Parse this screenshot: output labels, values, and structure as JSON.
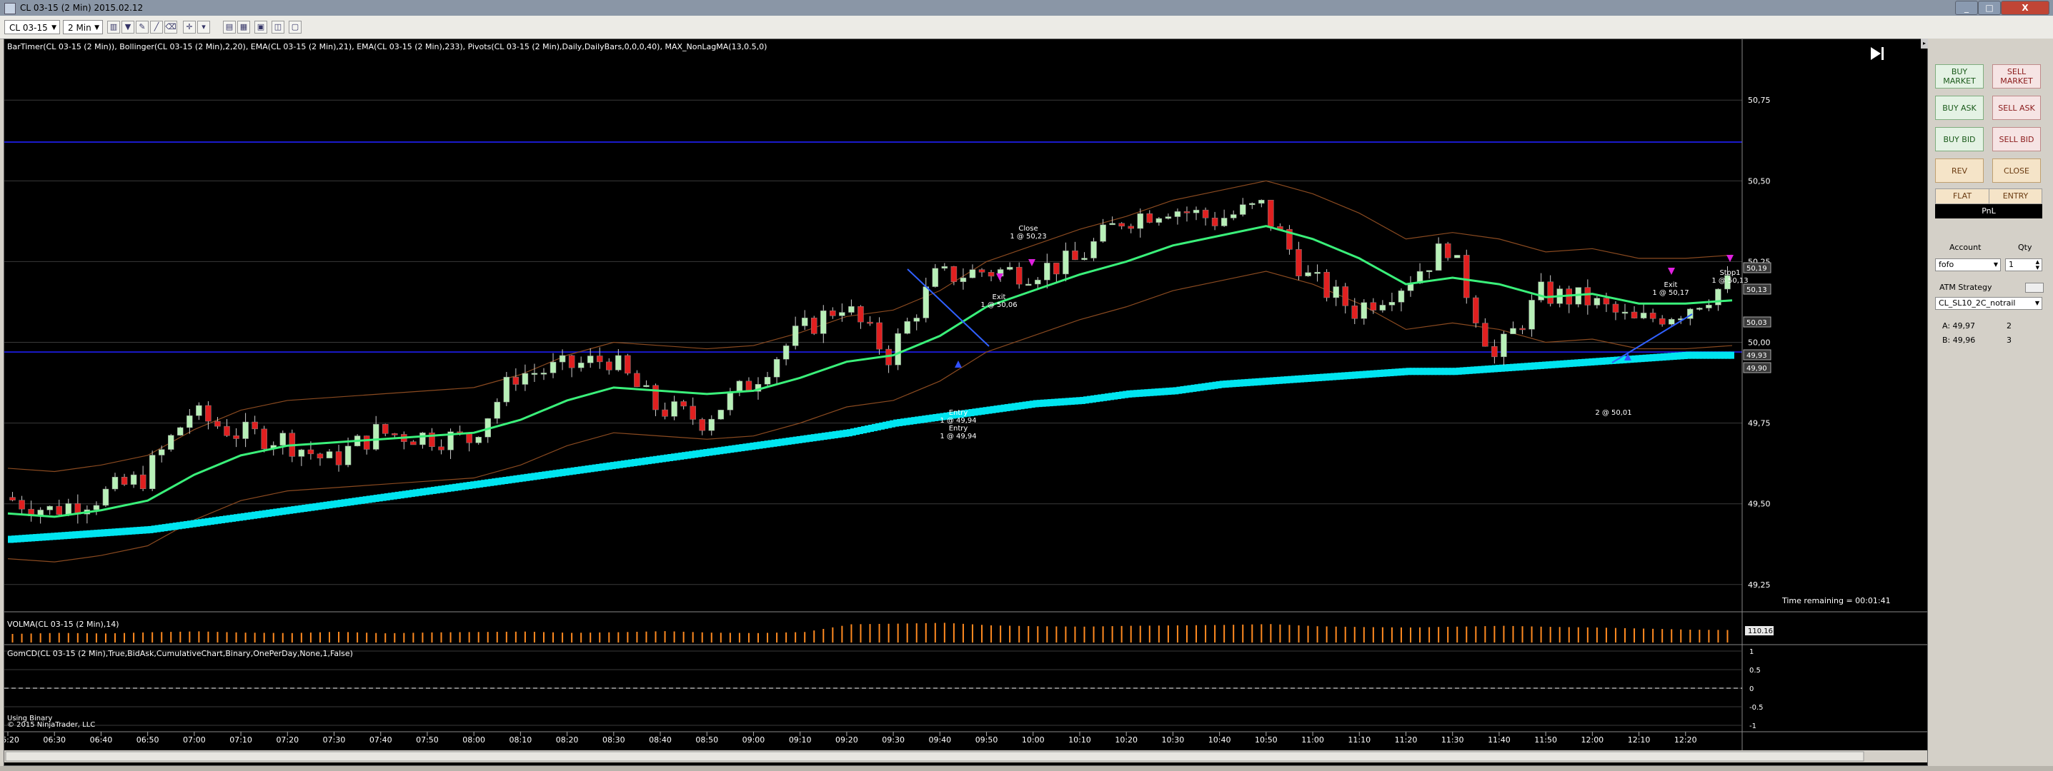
{
  "window": {
    "title": "CL 03-15 (2 Min)  2015.02.12",
    "close_label": "X",
    "min_label": "_",
    "max_label": "□"
  },
  "toolbar": {
    "instrument": "CL 03-15",
    "interval": "2 Min"
  },
  "chart": {
    "indicators_label": "BarTimer(CL 03-15 (2 Min)), Bollinger(CL 03-15 (2 Min),2,20), EMA(CL 03-15 (2 Min),21), EMA(CL 03-15 (2 Min),233), Pivots(CL 03-15 (2 Min),Daily,DailyBars,0,0,0,40), MAX_NonLagMA(13,0.5,0)",
    "time_remaining": "Time remaining = 00:01:41",
    "price_labels": [
      "50,75",
      "50,50",
      "50,25",
      "50,00",
      "49,75",
      "49,50",
      "49,25"
    ],
    "price_flags": [
      {
        "text": "50,19",
        "color": "#ffffff"
      },
      {
        "text": "50,13",
        "color": "#ffffff"
      },
      {
        "text": "50,03",
        "color": "#ffffff"
      },
      {
        "text": "49,93",
        "color": "#ffffff"
      },
      {
        "text": "49,90",
        "color": "#ffffff"
      }
    ],
    "time_labels": [
      "06:20",
      "06:30",
      "06:40",
      "06:50",
      "07:00",
      "07:10",
      "07:20",
      "07:30",
      "07:40",
      "07:50",
      "08:00",
      "08:10",
      "08:20",
      "08:30",
      "08:40",
      "08:50",
      "09:00",
      "09:10",
      "09:20",
      "09:30",
      "09:40",
      "09:50",
      "10:00",
      "10:10",
      "10:20",
      "10:30",
      "10:40",
      "10:50",
      "11:00",
      "11:10",
      "11:20",
      "11:30",
      "11:40",
      "11:50",
      "12:00",
      "12:10",
      "12:20"
    ],
    "volume_label": "VOLMA(CL 03-15 (2 Min),14)",
    "volume_value": "110.16",
    "gomcd_label": "GomCD(CL 03-15 (2 Min),True,BidAsk,CumulativeChart,Binary,OnePerDay,None,1,False)",
    "gomcd_ticks": [
      "1",
      "0.5",
      "0",
      "-0.5",
      "-1"
    ],
    "using_label": "Using Binary",
    "copyright": "© 2015 NinjaTrader, LLC",
    "trade_annotations": [
      {
        "lines": [
          "Close",
          "1 @ 50,23"
        ]
      },
      {
        "lines": [
          "Exit",
          "1 @ 50,06"
        ]
      },
      {
        "lines": [
          "Entry",
          "1 @ 49,94",
          "Entry",
          "1 @ 49,94"
        ]
      },
      {
        "lines": [
          "Exit",
          "1 @ 50,17"
        ]
      },
      {
        "lines": [
          "Stop1",
          "1 @ 50,13"
        ]
      },
      {
        "lines": [
          "2 @ 50,01"
        ]
      }
    ]
  },
  "chart_data": {
    "type": "line",
    "title": "CL 03-15 (2 Min)",
    "xlabel": "",
    "ylabel": "",
    "ylim": [
      49.17,
      50.85
    ],
    "x": [
      "06:20",
      "06:30",
      "06:40",
      "06:50",
      "07:00",
      "07:10",
      "07:20",
      "07:30",
      "07:40",
      "07:50",
      "08:00",
      "08:10",
      "08:20",
      "08:30",
      "08:40",
      "08:50",
      "09:00",
      "09:10",
      "09:20",
      "09:30",
      "09:40",
      "09:50",
      "10:00",
      "10:10",
      "10:20",
      "10:30",
      "10:40",
      "10:50",
      "11:00",
      "11:10",
      "11:20",
      "11:30",
      "11:40",
      "11:50",
      "12:00",
      "12:10",
      "12:20",
      "12:26"
    ],
    "series": [
      {
        "name": "EMA(21)",
        "values": [
          49.47,
          49.46,
          49.48,
          49.51,
          49.59,
          49.65,
          49.68,
          49.69,
          49.7,
          49.71,
          49.72,
          49.76,
          49.82,
          49.86,
          49.85,
          49.84,
          49.85,
          49.89,
          49.94,
          49.96,
          50.02,
          50.11,
          50.16,
          50.21,
          50.25,
          50.3,
          50.33,
          50.36,
          50.32,
          50.26,
          50.18,
          50.2,
          50.18,
          50.14,
          50.15,
          50.12,
          50.12,
          50.13
        ]
      },
      {
        "name": "EMA(233)",
        "values": [
          49.39,
          49.4,
          49.41,
          49.42,
          49.44,
          49.46,
          49.48,
          49.5,
          49.52,
          49.54,
          49.56,
          49.58,
          49.6,
          49.62,
          49.64,
          49.66,
          49.68,
          49.7,
          49.72,
          49.75,
          49.77,
          49.79,
          49.81,
          49.82,
          49.84,
          49.85,
          49.87,
          49.88,
          49.89,
          49.9,
          49.91,
          49.91,
          49.92,
          49.93,
          49.94,
          49.95,
          49.96,
          49.96
        ]
      },
      {
        "name": "Close",
        "values": [
          49.52,
          49.48,
          49.52,
          49.58,
          49.78,
          49.72,
          49.7,
          49.63,
          49.72,
          49.71,
          49.7,
          49.9,
          49.92,
          49.95,
          49.8,
          49.76,
          49.87,
          50.02,
          50.12,
          49.96,
          50.2,
          50.22,
          50.22,
          50.25,
          50.38,
          50.42,
          50.38,
          50.42,
          50.2,
          50.1,
          50.18,
          50.3,
          49.95,
          50.15,
          50.13,
          50.06,
          50.1,
          50.18
        ]
      }
    ],
    "horizontal_lines": [
      50.62,
      49.97
    ],
    "volume": {
      "name": "VOLMA",
      "values": [
        40,
        45,
        42,
        48,
        52,
        46,
        44,
        50,
        43,
        47,
        49,
        51,
        45,
        48,
        53,
        46,
        44,
        49,
        85,
        88,
        92,
        80,
        76,
        74,
        78,
        80,
        82,
        86,
        76,
        72,
        70,
        74,
        78,
        73,
        70,
        65,
        60,
        58
      ]
    },
    "grid": true,
    "legend": "none"
  },
  "order_panel": {
    "buy_market": "BUY MARKET",
    "sell_market": "SELL MARKET",
    "buy_ask": "BUY ASK",
    "sell_ask": "SELL ASK",
    "buy_bid": "BUY BID",
    "sell_bid": "SELL BID",
    "rev": "REV",
    "close": "CLOSE",
    "flat": "FLAT",
    "entry": "ENTRY",
    "pnl": "PnL",
    "account_label": "Account",
    "qty_label": "Qty",
    "account_value": "fofo",
    "qty_value": "1",
    "atm_label": "ATM Strategy",
    "atm_value": "CL_SL10_2C_notrail",
    "ask_label": "A:  49,97",
    "ask_size": "2",
    "bid_label": "B:  49,96",
    "bid_size": "3"
  }
}
